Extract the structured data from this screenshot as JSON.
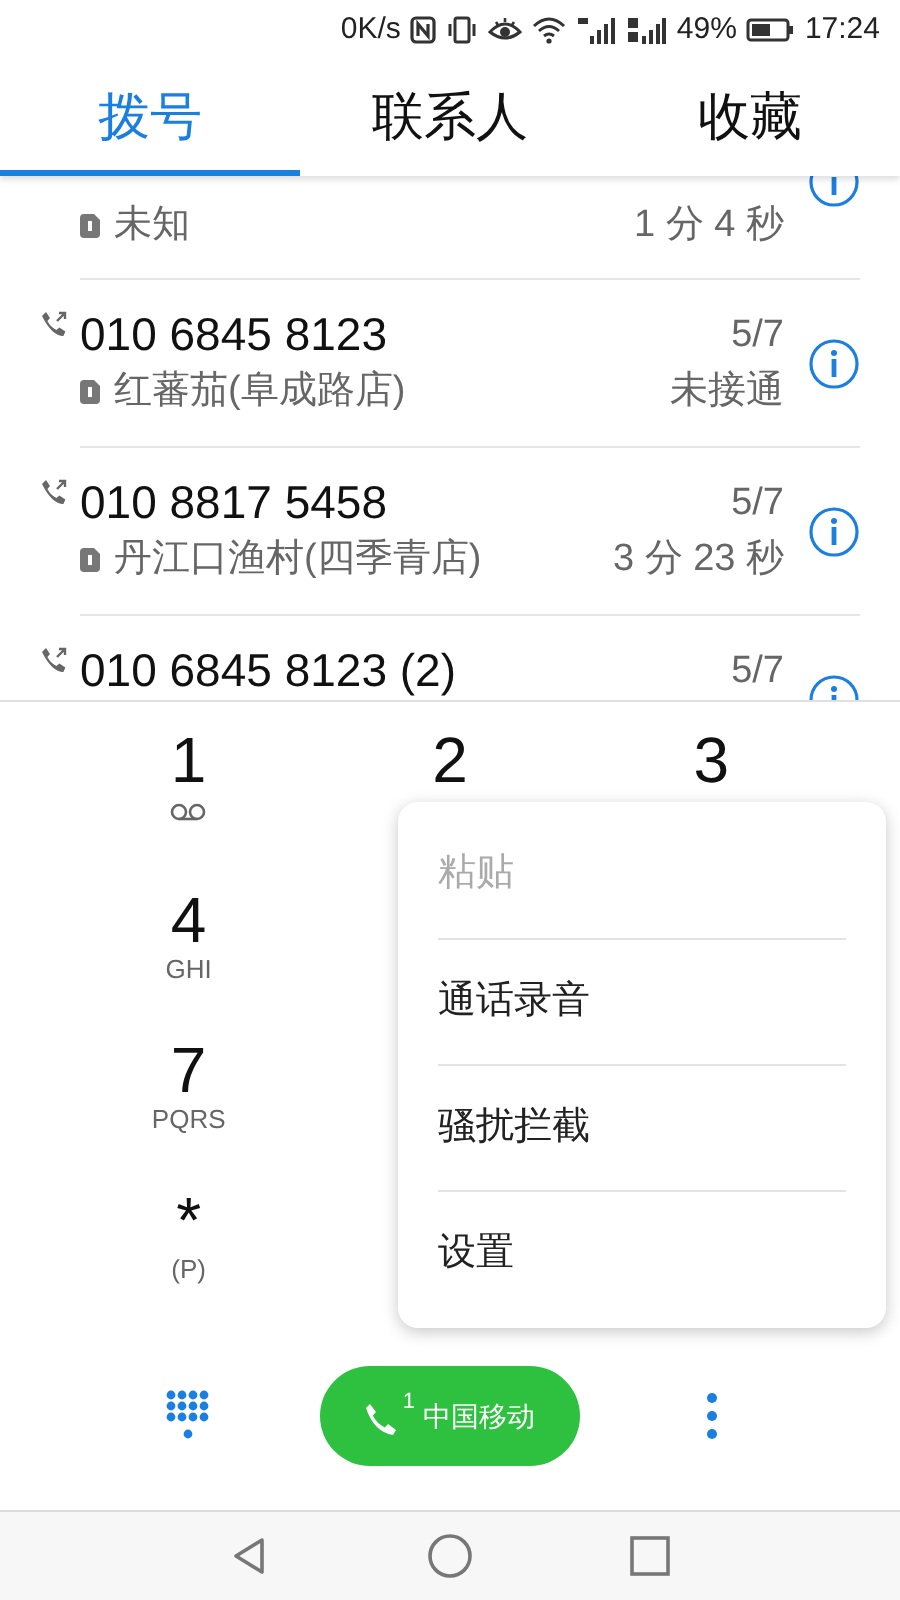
{
  "status_bar": {
    "speed": "0K/s",
    "battery": "49%",
    "time": "17:24"
  },
  "tabs": [
    {
      "label": "拨号",
      "selected": true
    },
    {
      "label": "联系人",
      "selected": false
    },
    {
      "label": "收藏",
      "selected": false
    }
  ],
  "calls": [
    {
      "sim": "未知",
      "detail": "1 分 4 秒"
    },
    {
      "number": "010 6845 8123",
      "sim": "红蕃茄(阜成路店)",
      "date": "5/7",
      "detail": "未接通"
    },
    {
      "number": "010 8817 5458",
      "sim": "丹江口渔村(四季青店)",
      "date": "5/7",
      "detail": "3 分 23 秒"
    },
    {
      "number": "010 6845 8123 (2)",
      "date": "5/7"
    }
  ],
  "dialpad": {
    "rows": [
      [
        {
          "digit": "1",
          "kind": "voicemail"
        },
        {
          "digit": "2",
          "kind": "plain"
        },
        {
          "digit": "3",
          "kind": "plain"
        }
      ],
      [
        {
          "digit": "4",
          "kind": "letters",
          "letters": "GHI"
        }
      ],
      [
        {
          "digit": "7",
          "kind": "letters",
          "letters": "PQRS"
        }
      ],
      [
        {
          "digit": "*",
          "kind": "letters",
          "letters": "(P)"
        }
      ]
    ]
  },
  "menu": {
    "items": [
      {
        "label": "粘贴",
        "disabled": true
      },
      {
        "label": "通话录音",
        "disabled": false
      },
      {
        "label": "骚扰拦截",
        "disabled": false
      },
      {
        "label": "设置",
        "disabled": false
      }
    ]
  },
  "call_button": {
    "sim": "1",
    "label": "中国移动"
  }
}
